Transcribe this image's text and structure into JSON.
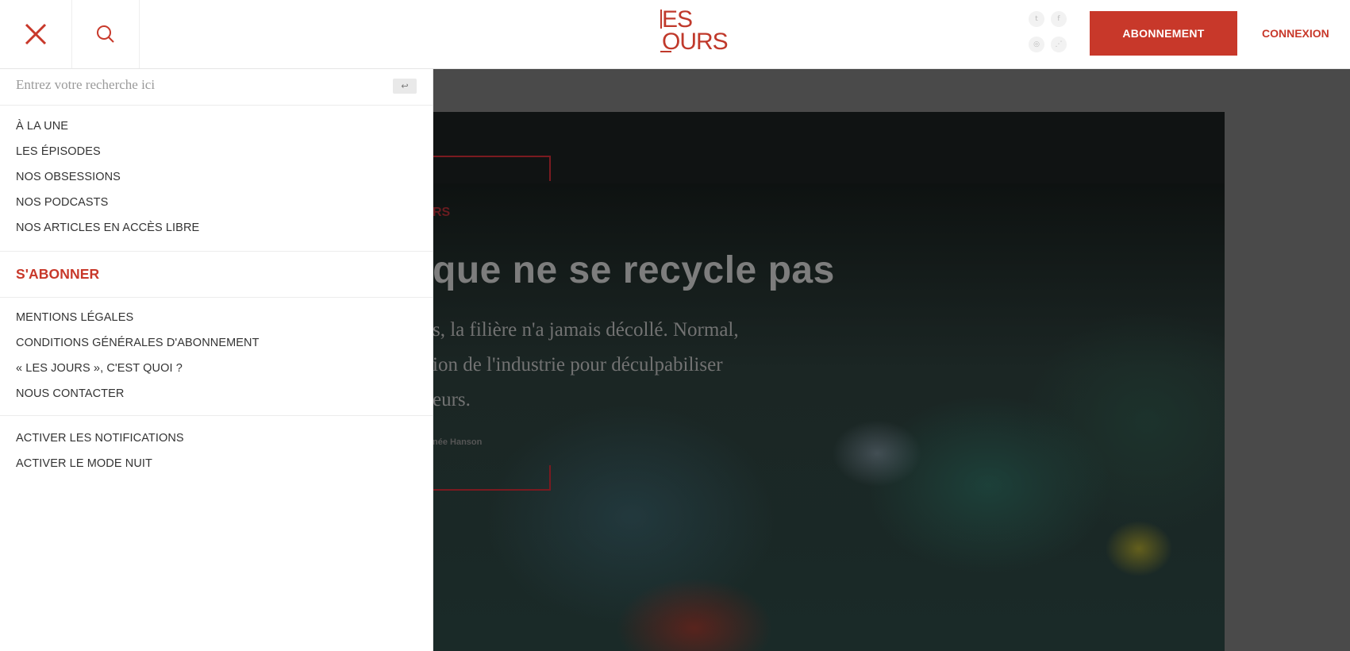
{
  "header": {
    "logo_line1": "ES",
    "logo_line2": "OURS",
    "social": [
      "twitter-icon",
      "facebook-icon",
      "instagram-icon",
      "rss-icon"
    ],
    "subscribe_label": "ABONNEMENT",
    "login_label": "CONNEXION",
    "accent_color": "#c8382a"
  },
  "menu": {
    "search_placeholder": "Entrez votre recherche ici",
    "search_submit_icon": "enter-icon",
    "primary": [
      "À LA UNE",
      "LES ÉPISODES",
      "NOS OBSESSIONS",
      "NOS PODCASTS",
      "NOS ARTICLES EN ACCÈS LIBRE"
    ],
    "subscribe": "S'ABONNER",
    "secondary": [
      "MENTIONS LÉGALES",
      "CONDITIONS GÉNÉRALES D'ABONNEMENT",
      "« LES JOURS », C'EST QUOI ?",
      "NOUS CONTACTER"
    ],
    "settings": [
      "ACTIVER LES NOTIFICATIONS",
      "ACTIVER LE MODE NUIT"
    ]
  },
  "article": {
    "kicker": "RS",
    "title": "que ne se recycle pas",
    "lede_lines": [
      "s, la filière n'a jamais décollé. Normal,",
      "ion de l'industrie pour déculpabiliser",
      "eurs."
    ],
    "byline": "née Hanson"
  }
}
